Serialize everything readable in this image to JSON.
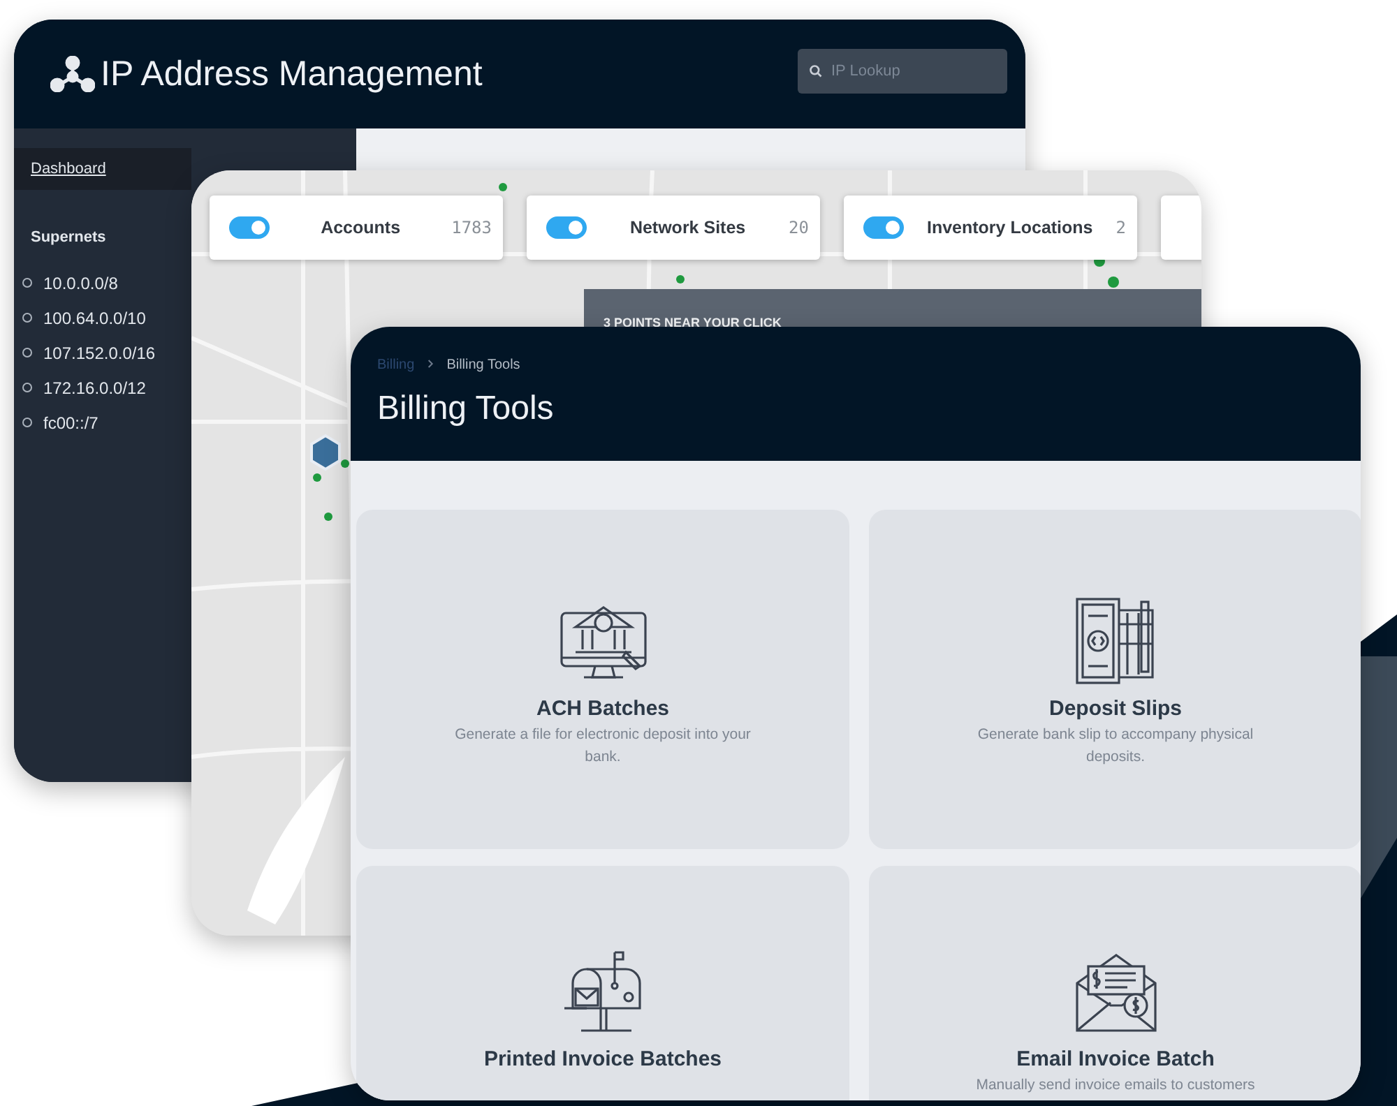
{
  "ipam_window": {
    "title": "IP Address Management",
    "search": {
      "placeholder": "IP Lookup"
    },
    "sidebar": {
      "items": [
        {
          "label": "Dashboard",
          "selected": true
        }
      ],
      "section_title": "Supernets",
      "supernets": [
        "10.0.0.0/8",
        "100.64.0.0/10",
        "107.152.0.0/16",
        "172.16.0.0/12",
        "fc00::/7"
      ]
    }
  },
  "map_window": {
    "layers": [
      {
        "label": "Accounts",
        "count": "1783",
        "on": true
      },
      {
        "label": "Network Sites",
        "count": "20",
        "on": true
      },
      {
        "label": "Inventory Locations",
        "count": "2",
        "on": true
      }
    ],
    "popup": {
      "title": "3 POINTS NEAR YOUR CLICK"
    }
  },
  "billing_window": {
    "breadcrumb": [
      "Billing",
      "Billing Tools"
    ],
    "title": "Billing Tools",
    "tools": [
      {
        "kind": "bank",
        "title": "ACH Batches",
        "description": "Generate a file for electronic deposit into your bank."
      },
      {
        "kind": "slip",
        "title": "Deposit Slips",
        "description": "Generate bank slip to accompany physical deposits."
      },
      {
        "kind": "mailbox",
        "title": "Printed Invoice Batches"
      },
      {
        "kind": "envelope",
        "title": "Email Invoice Batch",
        "description": "Manually send invoice emails to customers"
      }
    ]
  }
}
